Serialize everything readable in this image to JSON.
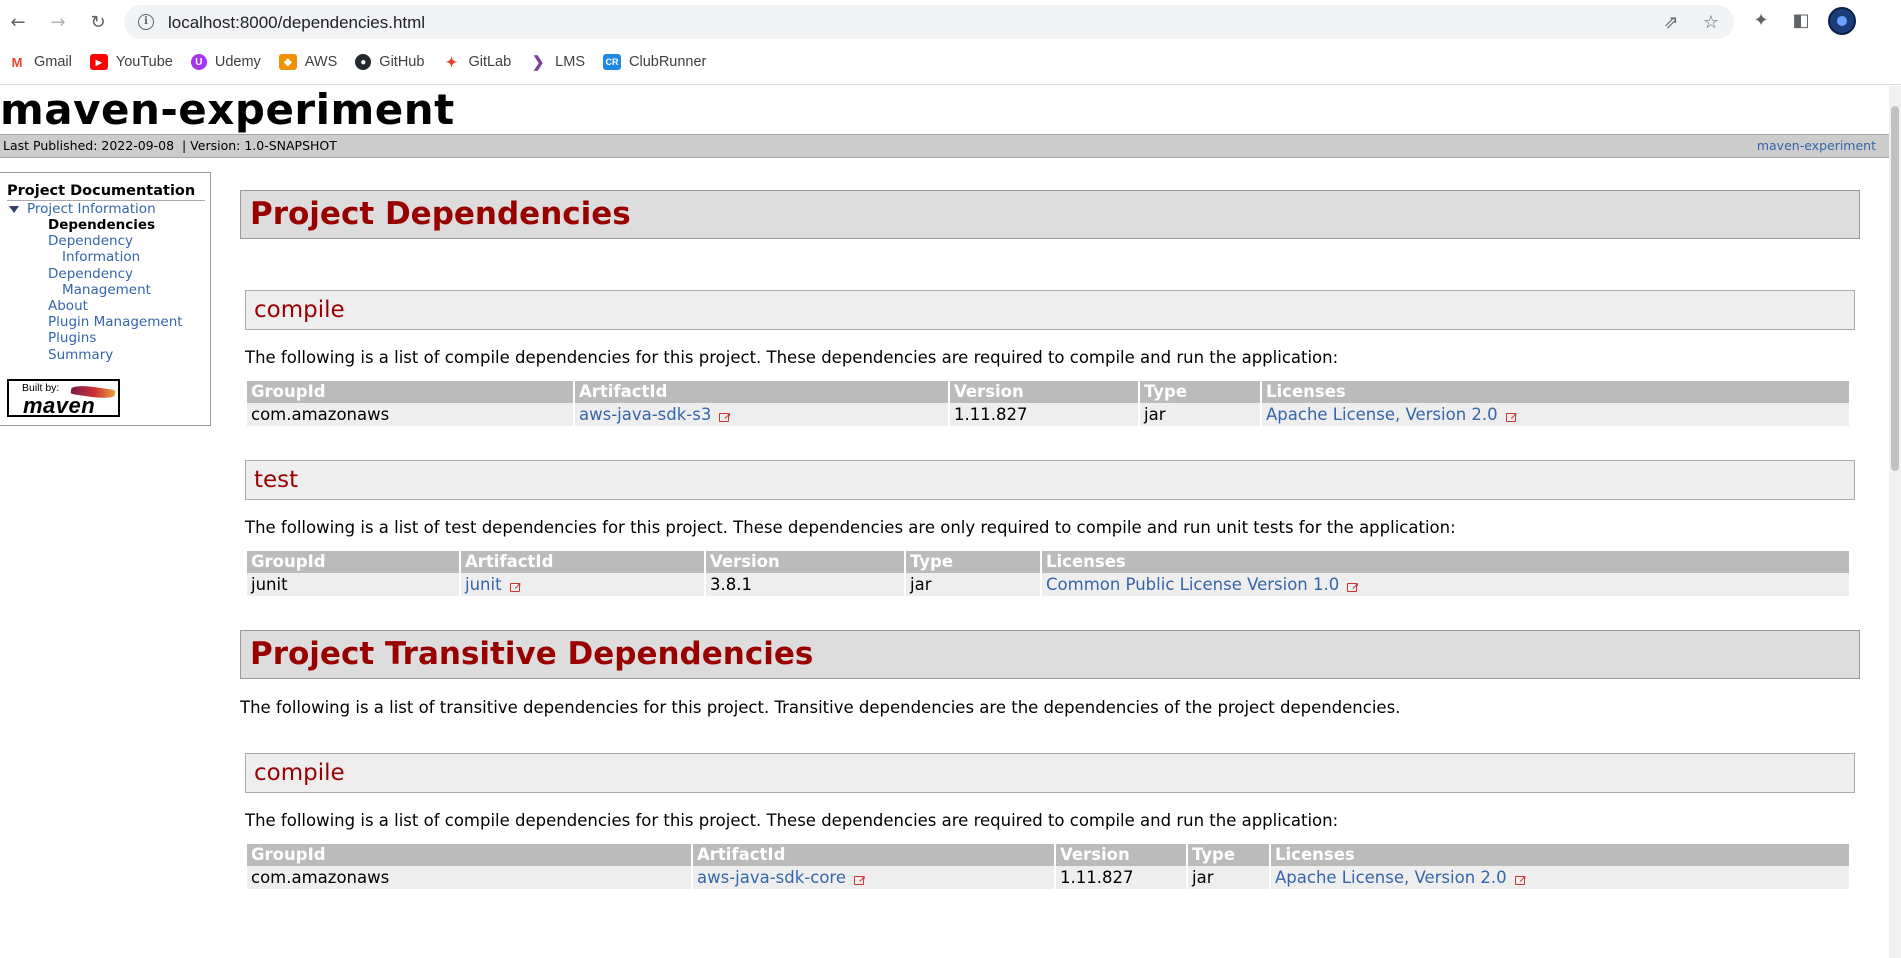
{
  "browser": {
    "url": "localhost:8000/dependencies.html",
    "bookmarks": [
      {
        "label": "Gmail",
        "icon": "gmail-icon",
        "color": "#ea4335",
        "glyph": "M"
      },
      {
        "label": "YouTube",
        "icon": "youtube-icon",
        "color": "#ff0000",
        "glyph": "▶"
      },
      {
        "label": "Udemy",
        "icon": "udemy-icon",
        "color": "#a435f0",
        "glyph": "U"
      },
      {
        "label": "AWS",
        "icon": "aws-icon",
        "color": "#f29100",
        "glyph": "◆"
      },
      {
        "label": "GitHub",
        "icon": "github-icon",
        "color": "#24292f",
        "glyph": "●"
      },
      {
        "label": "GitLab",
        "icon": "gitlab-icon",
        "color": "#e24329",
        "glyph": "✦"
      },
      {
        "label": "LMS",
        "icon": "lms-icon",
        "color": "#7b3f9e",
        "glyph": "❯"
      },
      {
        "label": "ClubRunner",
        "icon": "clubrunner-icon",
        "color": "#1e88e5",
        "glyph": "CR"
      }
    ]
  },
  "site": {
    "title": "maven-experiment",
    "last_published": "Last Published: 2022-09-08",
    "version": "| Version: 1.0-SNAPSHOT",
    "breadcrumb_right": "maven-experiment"
  },
  "nav": {
    "heading": "Project Documentation",
    "project_info": "Project Information",
    "items": {
      "dependencies": "Dependencies",
      "dependency_information_1": "Dependency",
      "dependency_information_2": "Information",
      "dependency_management_1": "Dependency",
      "dependency_management_2": "Management",
      "about": "About",
      "plugin_management": "Plugin Management",
      "plugins": "Plugins",
      "summary": "Summary"
    },
    "built_by_small": "Built by:",
    "built_by_big": "maven"
  },
  "content": {
    "project_dependencies": "Project Dependencies",
    "compile_heading": "compile",
    "compile_text": "The following is a list of compile dependencies for this project. These dependencies are required to compile and run the application:",
    "test_heading": "test",
    "test_text": "The following is a list of test dependencies for this project. These dependencies are only required to compile and run unit tests for the application:",
    "transitive_heading": "Project Transitive Dependencies",
    "transitive_text": "The following is a list of transitive dependencies for this project. Transitive dependencies are the dependencies of the project dependencies.",
    "transitive_compile_heading": "compile",
    "transitive_compile_text": "The following is a list of compile dependencies for this project. These dependencies are required to compile and run the application:",
    "columns": {
      "group": "GroupId",
      "artifact": "ArtifactId",
      "version": "Version",
      "type": "Type",
      "licenses": "Licenses"
    },
    "compile_row": {
      "group": "com.amazonaws",
      "artifact": "aws-java-sdk-s3",
      "version": "1.11.827",
      "type": "jar",
      "license": "Apache License, Version 2.0"
    },
    "test_row": {
      "group": "junit",
      "artifact": "junit",
      "version": "3.8.1",
      "type": "jar",
      "license": "Common Public License Version 1.0"
    },
    "transitive_row": {
      "group": "com.amazonaws",
      "artifact": "aws-java-sdk-core",
      "version": "1.11.827",
      "type": "jar",
      "license": "Apache License, Version 2.0"
    }
  }
}
